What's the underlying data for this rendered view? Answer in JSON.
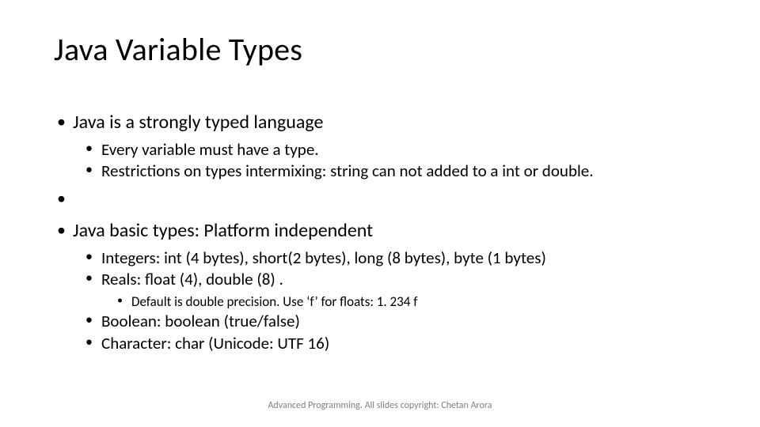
{
  "title": "Java Variable Types",
  "b1": {
    "text": "Java is a strongly typed language",
    "sub": {
      "a": "Every variable must have a type.",
      "b": "Restrictions on types intermixing: string can not added to a int or double."
    }
  },
  "b2": {
    "text": "Java basic types: Platform independent",
    "sub": {
      "a": "Integers: int  (4 bytes),  short(2 bytes),  long  (8 bytes),  byte  (1 bytes)",
      "b": "Reals: float  (4),  double  (8) .",
      "b_sub": "Default is double precision. Use ‘f’ for floats: 1. 234 f",
      "c": "Boolean: boolean (true/false)",
      "d": "Character: char (Unicode: UTF 16)"
    }
  },
  "footer": "Advanced Programming. All slides copyright: Chetan Arora"
}
